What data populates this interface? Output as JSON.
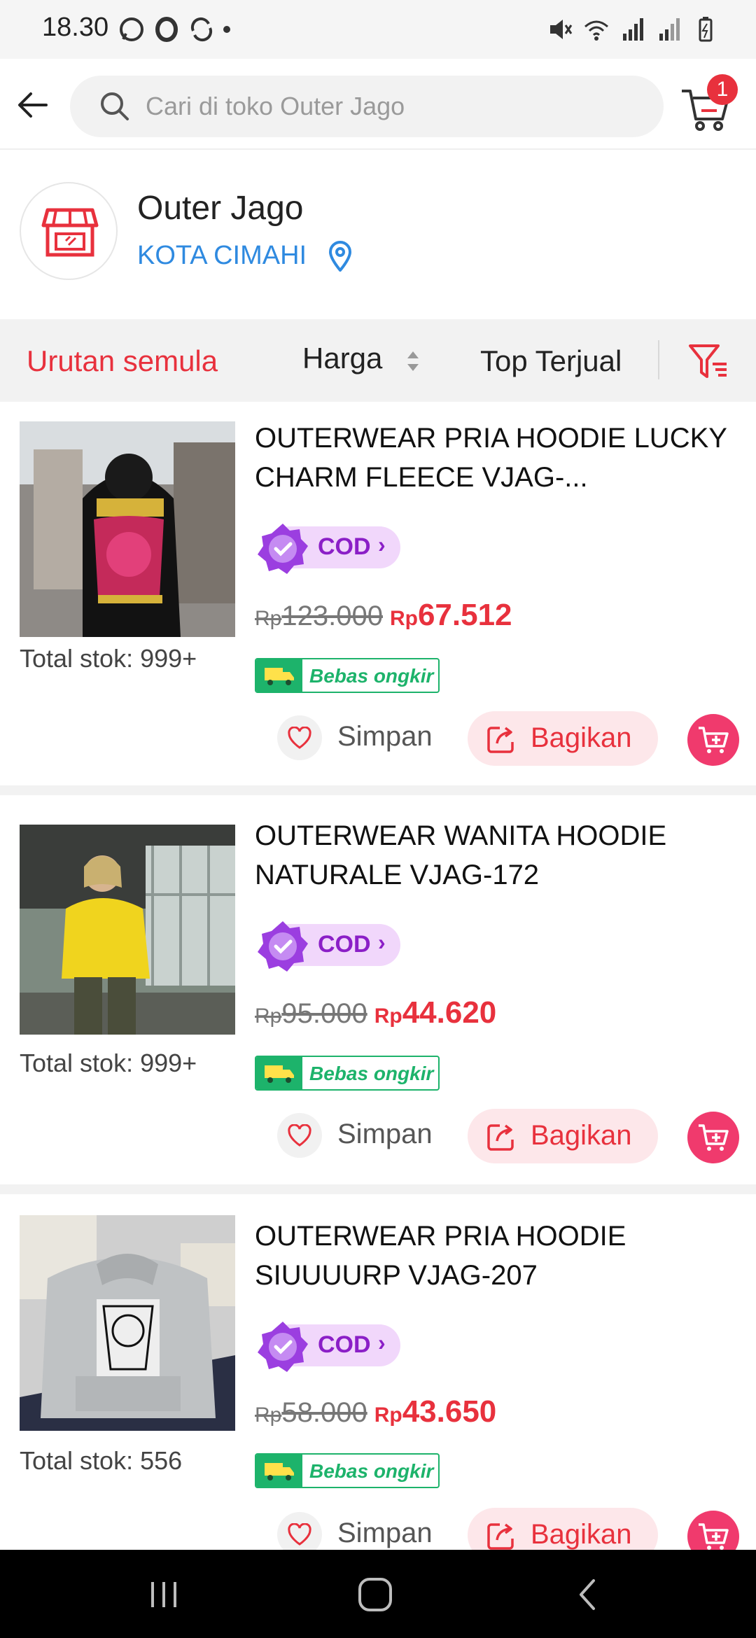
{
  "status_bar": {
    "time": "18.30"
  },
  "header": {
    "search_placeholder": "Cari di toko Outer Jago",
    "cart_badge": "1"
  },
  "shop": {
    "name": "Outer Jago",
    "city": "KOTA CIMAHI"
  },
  "sort": {
    "default": "Urutan semula",
    "price": "Harga",
    "top_sold": "Top Terjual"
  },
  "colors": {
    "accent": "#e8313d",
    "link": "#2f8ae0",
    "cod": "#8b1fc7",
    "free_shipping": "#1db36b",
    "cart_button": "#f03a6d"
  },
  "products": [
    {
      "title": "OUTERWEAR PRIA HOODIE LUCKY CHARM FLEECE VJAG-...",
      "cod": "COD",
      "currency": "Rp",
      "old_price": "123.000",
      "new_price": "67.512",
      "shipping": "Bebas ongkir",
      "stock": "Total stok: 999+",
      "save": "Simpan",
      "share": "Bagikan"
    },
    {
      "title": "OUTERWEAR WANITA HOODIE NATURALE VJAG-172",
      "cod": "COD",
      "currency": "Rp",
      "old_price": "95.000",
      "new_price": "44.620",
      "shipping": "Bebas ongkir",
      "stock": "Total stok: 999+",
      "save": "Simpan",
      "share": "Bagikan"
    },
    {
      "title": "OUTERWEAR PRIA HOODIE SIUUUURP VJAG-207",
      "cod": "COD",
      "currency": "Rp",
      "old_price": "58.000",
      "new_price": "43.650",
      "shipping": "Bebas ongkir",
      "stock": "Total stok: 556",
      "save": "Simpan",
      "share": "Bagikan"
    }
  ]
}
